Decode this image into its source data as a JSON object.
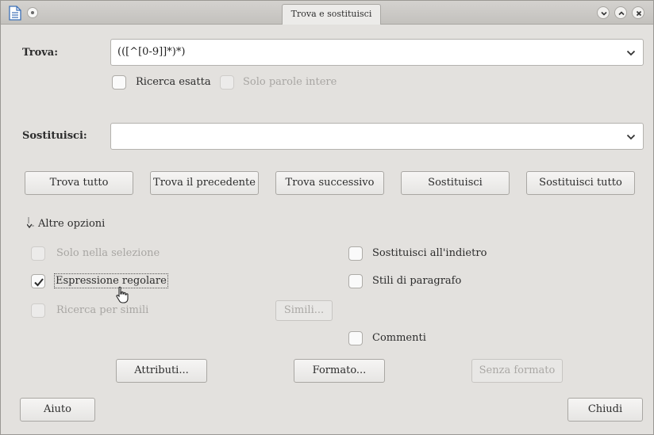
{
  "window": {
    "title": "Trova e sostituisci"
  },
  "find": {
    "label": "Trova:",
    "value": "(([^[0-9]]*)*)",
    "match_case_label": "Ricerca esatta",
    "whole_words_label": "Solo parole intere"
  },
  "replace": {
    "label": "Sostituisci:",
    "value": ""
  },
  "actions": {
    "find_all": "Trova tutto",
    "find_previous": "Trova il precedente",
    "find_next": "Trova successivo",
    "replace": "Sostituisci",
    "replace_all": "Sostituisci tutto"
  },
  "more_options": {
    "label": "Altre opzioni",
    "expanded": true,
    "current_selection_only": {
      "label": "Solo nella selezione",
      "checked": false,
      "enabled": false
    },
    "regular_expressions": {
      "label": "Espressione regolare",
      "checked": true,
      "enabled": true
    },
    "similarity_search": {
      "label": "Ricerca per simili",
      "checked": false,
      "enabled": false
    },
    "similarity_button": "Simili...",
    "replace_backwards": {
      "label": "Sostituisci all'indietro",
      "checked": false,
      "enabled": true
    },
    "paragraph_styles": {
      "label": "Stili di paragrafo",
      "checked": false,
      "enabled": true
    },
    "comments": {
      "label": "Commenti",
      "checked": false,
      "enabled": true
    },
    "attributes_button": "Attributi...",
    "format_button": "Formato...",
    "no_format_button": "Senza formato"
  },
  "footer": {
    "help": "Aiuto",
    "close": "Chiudi"
  },
  "icons": {
    "app": "document-icon",
    "pin": "pin-icon",
    "minimize": "minimize-icon",
    "maximize": "maximize-icon",
    "close": "close-icon",
    "dropdown": "chevron-down-icon",
    "check": "check-icon",
    "expander": "expander-arrow-icon",
    "cursor": "hand-pointer-icon"
  },
  "colors": {
    "window_bg": "#e3e1de",
    "titlebar_bg": "#c9c7c3",
    "check_color": "#2a2a2a"
  }
}
